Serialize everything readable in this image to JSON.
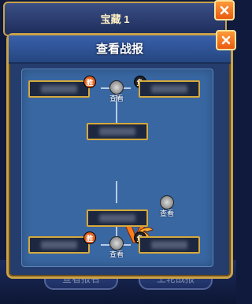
{
  "background_window": {
    "title": "宝藏 1"
  },
  "dialog": {
    "title": "查看战报"
  },
  "badges": {
    "win": "胜",
    "lose": "负"
  },
  "view_label": "查看",
  "bottom_buttons": {
    "left": "查看报名",
    "right": "上轮战报"
  },
  "colors": {
    "frame_gold": "#c9a24a",
    "board_blue": "#3967a2",
    "win_orange": "#e85a12"
  }
}
